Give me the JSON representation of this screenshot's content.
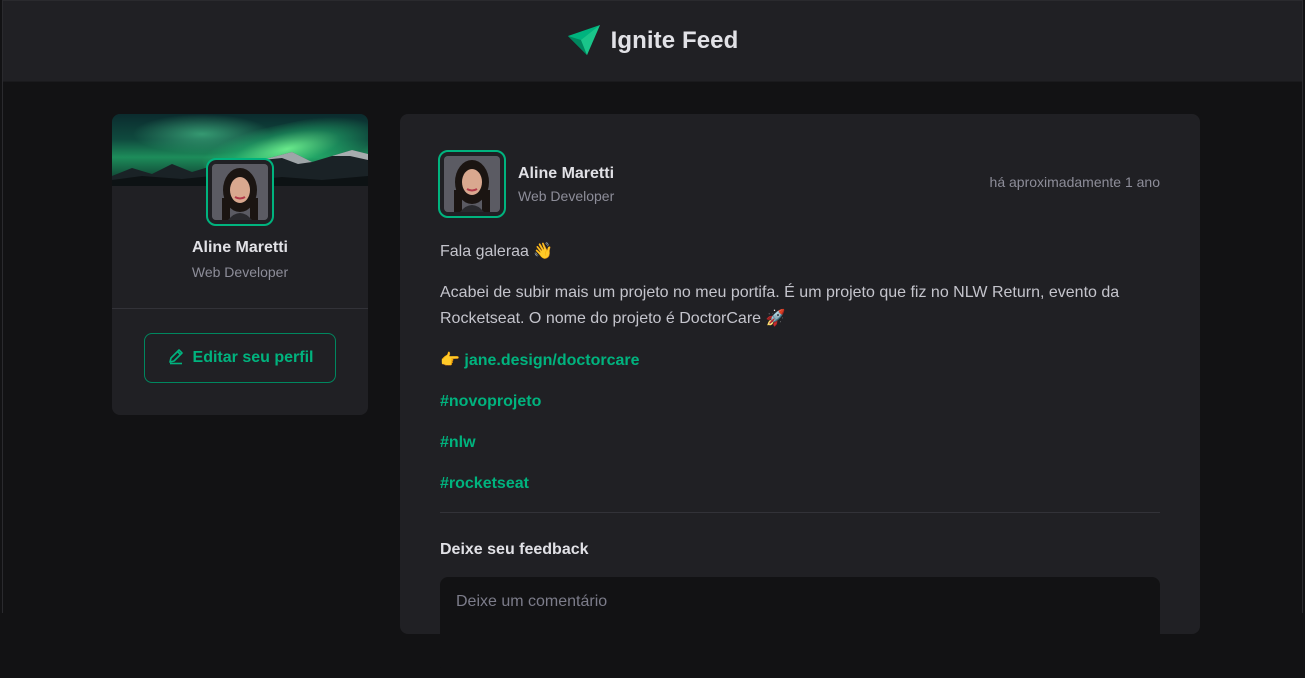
{
  "header": {
    "app_name": "Ignite Feed",
    "logo_icon": "ignite-arrow-logo"
  },
  "colors": {
    "accent": "#00b37e",
    "accent_dark": "#00875f",
    "background": "#121214",
    "card": "#202024",
    "text_primary": "#e1e1e6",
    "text_secondary": "#8d8d99"
  },
  "sidebar": {
    "cover": "aurora-landscape",
    "avatar": "user-avatar",
    "name": "Aline Maretti",
    "role": "Web Developer",
    "edit_button_label": "Editar seu perfil",
    "edit_icon": "pencil-icon"
  },
  "post": {
    "author": {
      "name": "Aline Maretti",
      "role": "Web Developer"
    },
    "published": "há aproximadamente 1 ano",
    "content": {
      "greeting": "Fala galeraa",
      "greeting_emoji": "👋",
      "paragraph_line1": "Acabei de subir mais um projeto no meu portifa. É um projeto que fiz no NLW Return, evento da",
      "paragraph_line2": "Rocketseat. O nome do projeto é DoctorCare",
      "paragraph_emoji": "🚀",
      "link_emoji": "👉",
      "link": "jane.design/doctorcare",
      "hashtags": [
        "#novoprojeto",
        "#nlw",
        "#rocketseat"
      ]
    },
    "feedback_title": "Deixe seu feedback",
    "comment_placeholder": "Deixe um comentário"
  }
}
